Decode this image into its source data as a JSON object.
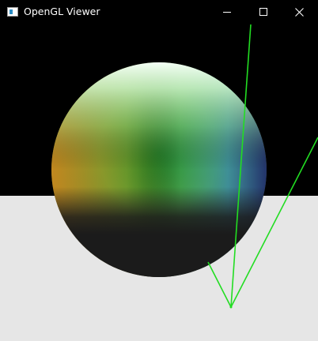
{
  "window": {
    "title": "OpenGL Viewer",
    "controls": {
      "minimize": "minimize-icon",
      "maximize": "maximize-icon",
      "close": "close-icon"
    }
  },
  "scene": {
    "background_color": "#000000",
    "floor_color": "#e6e6e6",
    "sphere": {
      "top_color": "#e8fff0",
      "center_color": "#1f8a22",
      "left_color": "#c89220",
      "right_color": "#2a4aa0",
      "shadow_color": "#1b1b1b"
    },
    "light_ray_color": "#22dd22"
  }
}
